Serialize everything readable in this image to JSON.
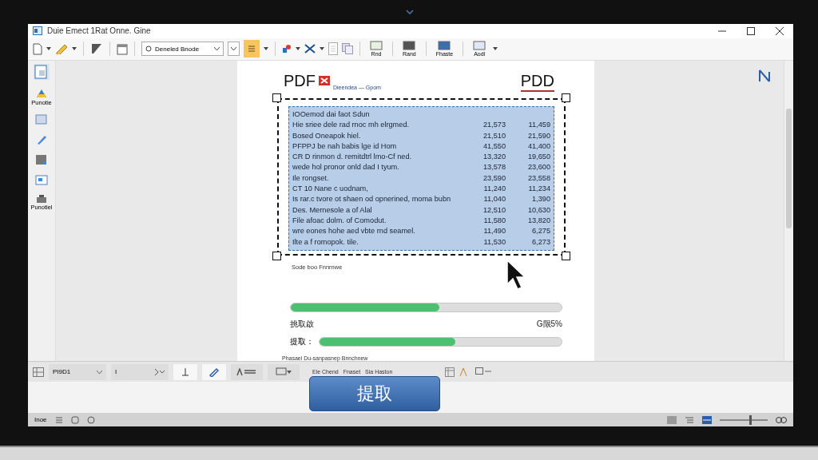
{
  "window": {
    "title": "Duie Emect 1Rat Onne. Gine"
  },
  "toolbar": {
    "combo_value": "Deneled Bnode",
    "labels": [
      "Rnd",
      "Rand",
      "Fhaste",
      "Aodl"
    ]
  },
  "sidebar": {
    "labels": [
      "Punotie",
      "Punotiel"
    ]
  },
  "document": {
    "logo": "PDF",
    "subtitle": "Dieendea — Gpom",
    "right_logo": "PDD",
    "rows": [
      {
        "text": "IOOemod dai faot Sdun",
        "col_2": "",
        "col_3": ""
      },
      {
        "text": "Hie sriee dele rad rnoc mh elrgmed.",
        "col_2": "21,573",
        "col_3": "11,459"
      },
      {
        "text": "Bosed Oneapok hiel.",
        "col_2": "21,510",
        "col_3": "21,590"
      },
      {
        "text": "PFPPJ be nah babis lge id Hom",
        "col_2": "41,550",
        "col_3": "41,400"
      },
      {
        "text": "CR D rinmon d. remitdtrl lmo-Cf ned.",
        "col_2": "13,320",
        "col_3": "19,650"
      },
      {
        "text": "wede hol pronor onld dad I tyum.",
        "col_2": "13,578",
        "col_3": "23,600"
      },
      {
        "text": "Ile rongset.",
        "col_2": "23,590",
        "col_3": "23,558"
      },
      {
        "text": "CT 10 Nane c uodnam,",
        "col_2": "11,240",
        "col_3": "11,234"
      },
      {
        "text": "Is rar.c tvore ot shaen od opnerined, moma bubn",
        "col_2": "11,040",
        "col_3": "1,390"
      },
      {
        "text": "Des. Mernesole a of Alal",
        "col_2": "12,510",
        "col_3": "10,630"
      },
      {
        "text": "File afoac dolm. of Comodut.",
        "col_2": "11,580",
        "col_3": "13,820"
      },
      {
        "text": "wre eones hohe aed vbte rnd seamel.",
        "col_2": "11,490",
        "col_3": "6,275"
      },
      {
        "text": "Ilte a f romopok. tile.",
        "col_2": "11,530",
        "col_3": "6,273"
      }
    ],
    "caption": "Sode boo Fnnrnwe",
    "progress": [
      {
        "level": 0.55
      },
      {
        "label": "挑取啟",
        "reading": "G限5%"
      }
    ],
    "extract_progress": {
      "label": "提取：",
      "level": 0.56
    },
    "footer": "Phasaei Du-sanpasnep Bnnchnew"
  },
  "bottom_toolbar": {
    "page_combo": "PI9D1",
    "font_combo": "I",
    "labels": [
      "Ele Chend",
      "Fnaset",
      "Sia Haston"
    ]
  },
  "extract_button": "提取",
  "status_bar": {
    "text": "Inoe",
    "zoom": {
      "level": 0.63
    }
  }
}
